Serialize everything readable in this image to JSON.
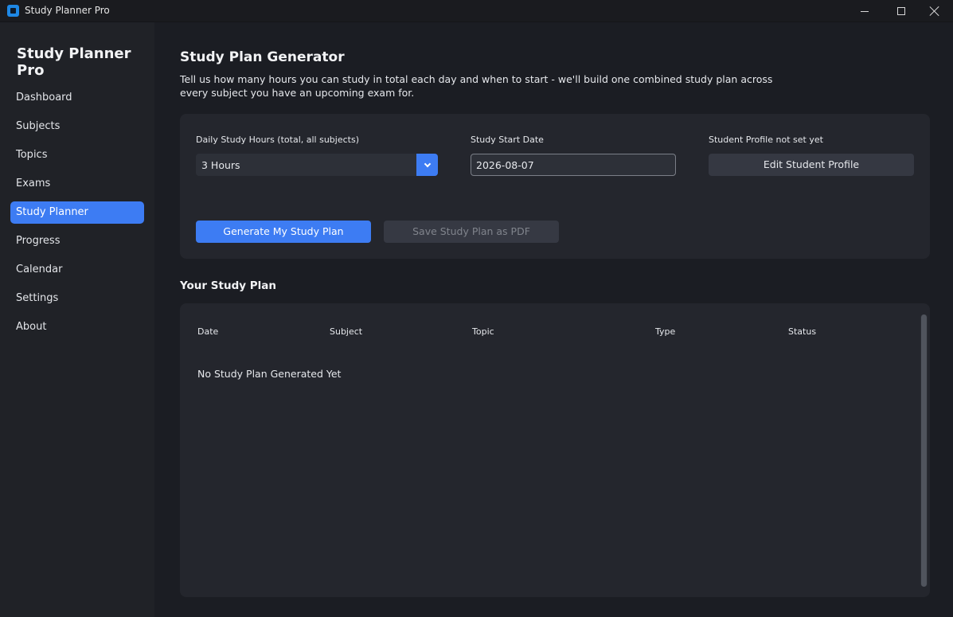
{
  "window": {
    "title": "Study Planner Pro"
  },
  "sidebar": {
    "brand": "Study Planner Pro",
    "items": [
      {
        "label": "Dashboard"
      },
      {
        "label": "Subjects"
      },
      {
        "label": "Topics"
      },
      {
        "label": "Exams"
      },
      {
        "label": "Study Planner",
        "active": true
      },
      {
        "label": "Progress"
      },
      {
        "label": "Calendar"
      },
      {
        "label": "Settings"
      },
      {
        "label": "About"
      }
    ]
  },
  "main": {
    "title": "Study Plan Generator",
    "description": "Tell us how many hours you can study in total each day and when to start - we'll build one combined study plan across every subject you have an upcoming exam for.",
    "form": {
      "hours_label": "Daily Study Hours (total, all subjects)",
      "hours_value": "3 Hours",
      "date_label": "Study Start Date",
      "date_value": "2026-08-07",
      "profile_label": "Student Profile not set yet",
      "profile_button": "Edit Student Profile",
      "generate_button": "Generate My Study Plan",
      "save_button": "Save Study Plan as PDF"
    },
    "plan": {
      "title": "Your Study Plan",
      "columns": [
        "Date",
        "Subject",
        "Topic",
        "Type",
        "Status"
      ],
      "empty_message": "No Study Plan Generated Yet"
    }
  },
  "colors": {
    "accent": "#3d7cf3",
    "background": "#1b1d23",
    "sidebar": "#202227",
    "panel": "#24262d"
  }
}
